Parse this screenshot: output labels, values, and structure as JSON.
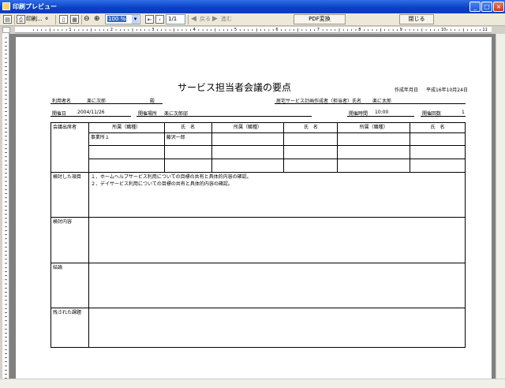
{
  "window": {
    "title": "印刷プレビュー"
  },
  "toolbar": {
    "print_label": "印刷...",
    "zoom_value": "100 %",
    "page_value": "1/1",
    "back_label": "戻る",
    "forward_label": "進む",
    "pdf_label": "PDF変換",
    "close_label": "閉じる"
  },
  "ruler": {
    "numbers": [
      "1",
      "2",
      "3",
      "4",
      "5",
      "6",
      "7",
      "8",
      "9",
      "10",
      "11"
    ]
  },
  "document": {
    "title": "サービス担当者会議の要点",
    "created_label": "作成年月日",
    "created_value": "平成16年10月24日",
    "user_label": "利用者名",
    "user_value": "楽に次郎",
    "honorific": "殿",
    "planner_label": "居宅サービス計画作成者（担当者）氏名",
    "planner_value": "楽に太郎",
    "date_label": "開催日",
    "date_value": "2004/11/26",
    "place_label": "開催場所",
    "place_value": "楽に次郎邸",
    "time_label": "開催時間",
    "time_value": "10:00",
    "count_label": "開催回数",
    "count_value": "1",
    "attendees_label": "会議出席者",
    "col_affiliation": "所属（職種）",
    "col_name": "氏　名",
    "attendee_affiliation": "事業所１",
    "attendee_name": "藤沢一郎",
    "examined_label": "検討した項目",
    "examined_item1": "１．ホームヘルプサービス利用についての目標の共有と具体的内容の確認。",
    "examined_item2": "２．デイサービス利用についての目標の共有と具体的内容の確認。",
    "content_label": "検討内容",
    "conclusion_label": "結論",
    "remaining_label": "残された課題"
  }
}
